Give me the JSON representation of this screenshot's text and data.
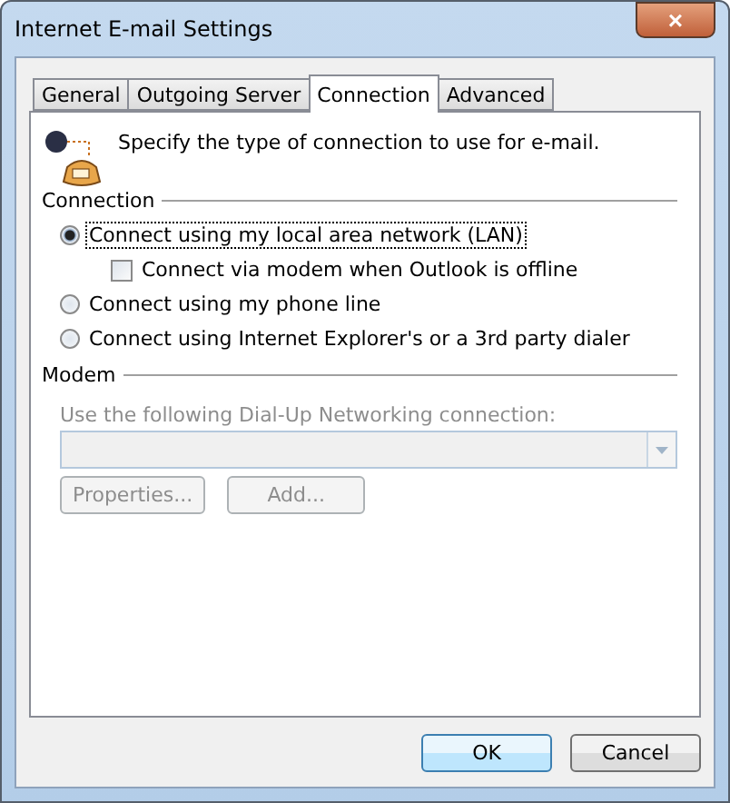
{
  "window": {
    "title": "Internet E-mail Settings",
    "close": "×"
  },
  "tabs": [
    {
      "label": "General",
      "selected": false
    },
    {
      "label": "Outgoing Server",
      "selected": false
    },
    {
      "label": "Connection",
      "selected": true
    },
    {
      "label": "Advanced",
      "selected": false
    }
  ],
  "intro": "Specify the type of connection to use for e-mail.",
  "connection": {
    "heading": "Connection",
    "options": [
      {
        "kind": "radio",
        "label": "Connect using my local area network (LAN)",
        "selected": true,
        "focused": true,
        "children": [
          {
            "kind": "checkbox",
            "label": "Connect via modem when Outlook is offline",
            "checked": false
          }
        ]
      },
      {
        "kind": "radio",
        "label": "Connect using my phone line",
        "selected": false,
        "focused": false
      },
      {
        "kind": "radio",
        "label": "Connect using Internet Explorer's or a 3rd party dialer",
        "selected": false,
        "focused": false
      }
    ]
  },
  "modem": {
    "heading": "Modem",
    "label": "Use the following Dial-Up Networking connection:",
    "disabled": true,
    "buttons": [
      "Properties...",
      "Add..."
    ]
  },
  "buttons": [
    "OK",
    "Cancel"
  ]
}
